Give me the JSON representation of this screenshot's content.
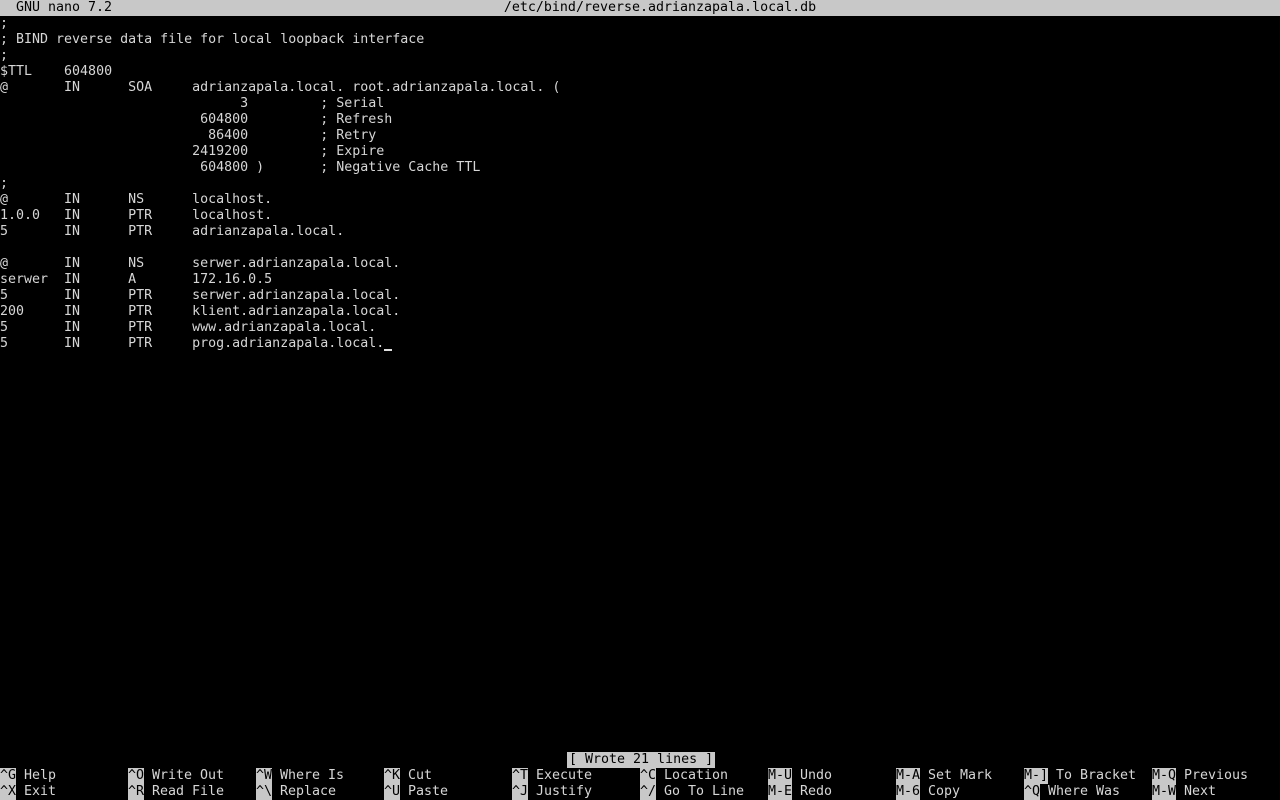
{
  "title_bar": {
    "version": "GNU nano 7.2",
    "filename": "/etc/bind/reverse.adrianzapala.local.db"
  },
  "editor_lines": [
    ";",
    "; BIND reverse data file for local loopback interface",
    ";",
    "$TTL    604800",
    "@       IN      SOA     adrianzapala.local. root.adrianzapala.local. (",
    "                              3         ; Serial",
    "                         604800         ; Refresh",
    "                          86400         ; Retry",
    "                        2419200         ; Expire",
    "                         604800 )       ; Negative Cache TTL",
    ";",
    "@       IN      NS      localhost.",
    "1.0.0   IN      PTR     localhost.",
    "5       IN      PTR     adrianzapala.local.",
    "",
    "@       IN      NS      serwer.adrianzapala.local.",
    "serwer  IN      A       172.16.0.5",
    "5       IN      PTR     serwer.adrianzapala.local.",
    "200     IN      PTR     klient.adrianzapala.local.",
    "5       IN      PTR     www.adrianzapala.local.",
    "5       IN      PTR     prog.adrianzapala.local."
  ],
  "status_message": "[ Wrote 21 lines ]",
  "shortcuts": [
    {
      "key": "^G",
      "label": "Help"
    },
    {
      "key": "^X",
      "label": "Exit"
    },
    {
      "key": "^O",
      "label": "Write Out"
    },
    {
      "key": "^R",
      "label": "Read File"
    },
    {
      "key": "^W",
      "label": "Where Is"
    },
    {
      "key": "^\\",
      "label": "Replace"
    },
    {
      "key": "^K",
      "label": "Cut"
    },
    {
      "key": "^U",
      "label": "Paste"
    },
    {
      "key": "^T",
      "label": "Execute"
    },
    {
      "key": "^J",
      "label": "Justify"
    },
    {
      "key": "^C",
      "label": "Location"
    },
    {
      "key": "^/",
      "label": "Go To Line"
    },
    {
      "key": "M-U",
      "label": "Undo"
    },
    {
      "key": "M-E",
      "label": "Redo"
    },
    {
      "key": "M-A",
      "label": "Set Mark"
    },
    {
      "key": "M-6",
      "label": "Copy"
    },
    {
      "key": "M-]",
      "label": "To Bracket"
    },
    {
      "key": "^Q",
      "label": "Where Was"
    },
    {
      "key": "M-Q",
      "label": "Previous"
    },
    {
      "key": "M-W",
      "label": "Next"
    }
  ],
  "colors": {
    "background": "#000000",
    "text": "#d6d6d6",
    "inverse_bg": "#c8c8c8",
    "inverse_fg": "#000000"
  }
}
